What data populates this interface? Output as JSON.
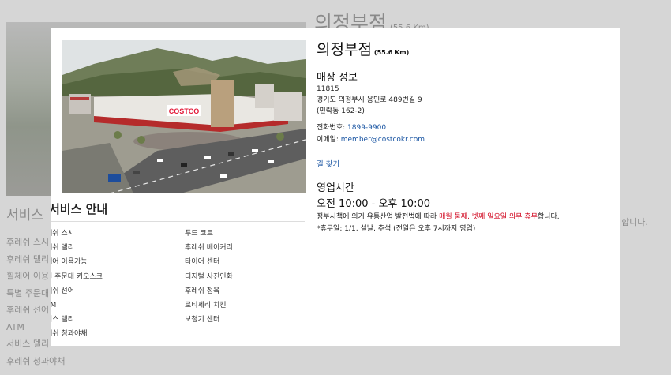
{
  "background": {
    "title": "의정부점",
    "distance": "(55.6 Km)",
    "services_title": "서비스",
    "services": [
      "후레쉬 스시",
      "후레쉬 델리",
      "휠체어 이용",
      "특별 주문대",
      "후레쉬 선어",
      "ATM",
      "서비스 델리",
      "후레쉬 청과야채"
    ],
    "trailing_text": "합니다."
  },
  "modal": {
    "store_name": "의정부점",
    "distance": "(55.6 Km)",
    "store_info_title": "매장 정보",
    "postal_code": "11815",
    "address": "경기도 의정부시 용민로 489번길 9",
    "address_lot": "(민락동 162-2)",
    "phone_label": "전화번호:",
    "phone": "1899-9900",
    "email_label": "이메일:",
    "email": "member@costcokr.com",
    "directions": "길 찾기",
    "hours_title": "영업시간",
    "hours": "오전 10:00 - 오후 10:00",
    "hours_note_prefix": "정부시책에 의거 유통산업 발전법에 따라 ",
    "hours_note_red": "매월 둘째, 넷째 일요일 의무 휴무",
    "hours_note_suffix": "합니다.",
    "holiday_note": "*휴무일: 1/1, 설날, 추석 (전일은 오후 7시까지 영업)",
    "services_title": "서비스 안내",
    "services_left": [
      "레쉬 스시",
      "레쉬 델리",
      "체어 이용가능",
      "별 주문대 키오스크",
      "레쉬 선어",
      "TM",
      "비스 델리",
      "레쉬 청과야채"
    ],
    "services_right": [
      "푸드 코트",
      "후레쉬 베이커리",
      "타이어 센터",
      "디지털 사진인화",
      "후레쉬 정육",
      "로티세리 치킨",
      "보청기 센터"
    ],
    "photo_sign": "COSTCO"
  },
  "colors": {
    "link": "#1b56a3",
    "notice_red": "#d0021b",
    "overlay": "#d6d6d6",
    "brand_red": "#e31837"
  }
}
